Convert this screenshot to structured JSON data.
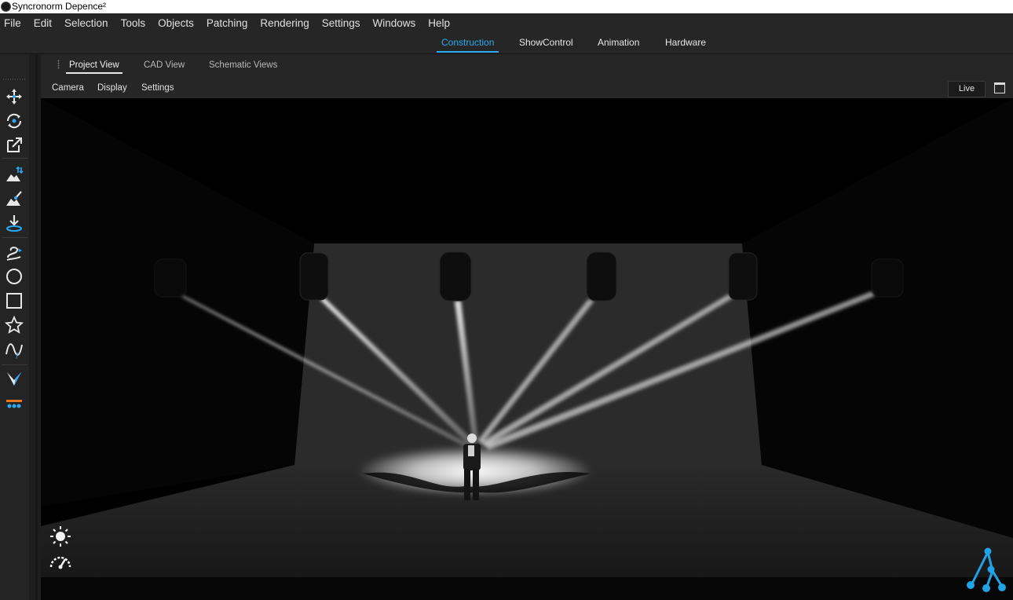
{
  "window": {
    "title": "Syncronorm Depence²"
  },
  "menu": [
    "File",
    "Edit",
    "Selection",
    "Tools",
    "Objects",
    "Patching",
    "Rendering",
    "Settings",
    "Windows",
    "Help"
  ],
  "mode_tabs": [
    {
      "label": "Construction",
      "active": true
    },
    {
      "label": "ShowControl",
      "active": false
    },
    {
      "label": "Animation",
      "active": false
    },
    {
      "label": "Hardware",
      "active": false
    }
  ],
  "view_tabs": [
    {
      "label": "Project View",
      "active": true
    },
    {
      "label": "CAD View",
      "active": false
    },
    {
      "label": "Schematic Views",
      "active": false
    }
  ],
  "view_toolbar": {
    "items": [
      "Camera",
      "Display",
      "Settings"
    ],
    "live_label": "Live"
  },
  "tools": [
    "move-icon",
    "rotate-icon",
    "scale-icon",
    "terrain-height-icon",
    "terrain-paint-icon",
    "drop-to-floor-icon",
    "spline-icon",
    "circle-icon",
    "rectangle-icon",
    "star-icon",
    "function-curve-icon",
    "v-shape-icon",
    "truss-icon"
  ],
  "viewport_overlays": [
    "light-icon",
    "performance-gauge-icon",
    "logo-icon"
  ],
  "colors": {
    "accent": "#2ea8f0",
    "background": "#1e1e1e",
    "viewport": "#000000"
  }
}
